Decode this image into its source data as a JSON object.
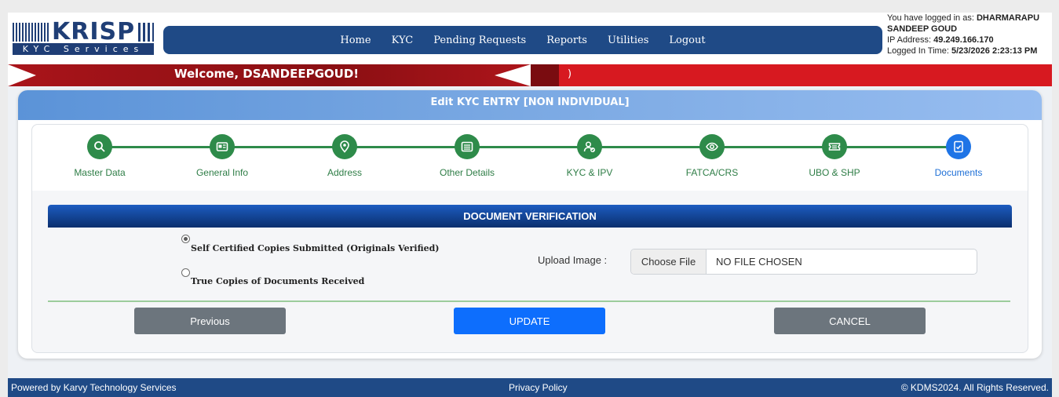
{
  "logo": {
    "name": "KRISP",
    "subtitle": "KYC Services"
  },
  "nav": [
    "Home",
    "KYC",
    "Pending Requests",
    "Reports",
    "Utilities",
    "Logout"
  ],
  "user": {
    "logged_prefix": "You have logged in as:",
    "name_line1": "DHARMARAPU",
    "name_line2": "SANDEEP GOUD",
    "ip_label": "IP Address:",
    "ip": "49.249.166.170",
    "time_label": "Logged In Time:",
    "time": "5/23/2026 2:23:13 PM"
  },
  "welcome": {
    "text": "Welcome, DSANDEEPGOUD!",
    "paren": ")"
  },
  "card": {
    "title": "Edit KYC ENTRY [NON INDIVIDUAL]"
  },
  "steps": [
    {
      "label": "Master Data",
      "icon": "search-icon",
      "active": false
    },
    {
      "label": "General Info",
      "icon": "id-card-icon",
      "active": false
    },
    {
      "label": "Address",
      "icon": "location-pin-icon",
      "active": false
    },
    {
      "label": "Other Details",
      "icon": "list-icon",
      "active": false
    },
    {
      "label": "KYC & IPV",
      "icon": "user-check-icon",
      "active": false
    },
    {
      "label": "FATCA/CRS",
      "icon": "eye-icon",
      "active": false
    },
    {
      "label": "UBO & SHP",
      "icon": "ticket-icon",
      "active": false
    },
    {
      "label": "Documents",
      "icon": "document-check-icon",
      "active": true
    }
  ],
  "doc": {
    "title": "DOCUMENT VERIFICATION",
    "option1": "Self Certified Copies Submitted (Originals Verified)",
    "option2": "True Copies of Documents Received",
    "selected": 1,
    "upload_label": "Upload Image :",
    "choose_file": "Choose File",
    "no_file": "NO FILE CHOSEN"
  },
  "buttons": {
    "previous": "Previous",
    "update": "UPDATE",
    "cancel": "CANCEL"
  },
  "footer": {
    "left": "Powered by Karvy Technology Services",
    "center": "Privacy Policy",
    "right": "© KDMS2024. All Rights Reserved."
  },
  "colors": {
    "nav": "#1f4a86",
    "red_band": "#d71920",
    "step_green": "#2e8b4a",
    "step_active": "#1e74e6",
    "update_btn": "#0d6efd",
    "grey_btn": "#6c757d"
  }
}
